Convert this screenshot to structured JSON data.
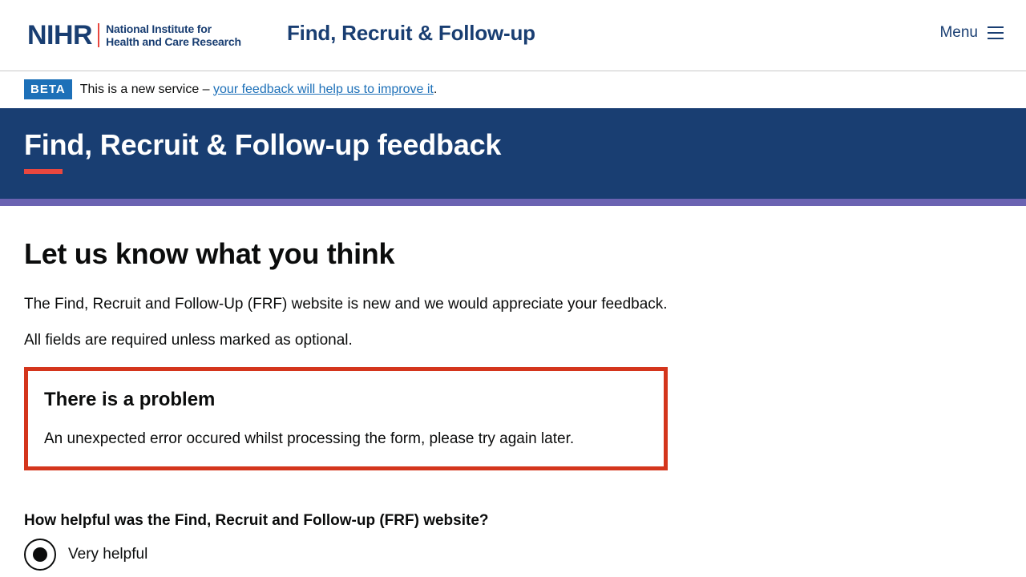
{
  "header": {
    "logo_mark": "NIHR",
    "logo_line1": "National Institute for",
    "logo_line2": "Health and Care Research",
    "service_name": "Find, Recruit & Follow-up",
    "menu_label": "Menu"
  },
  "beta": {
    "tag": "BETA",
    "text": "This is a new service – ",
    "link": "your feedback will help us to improve it",
    "suffix": "."
  },
  "hero": {
    "title": "Find, Recruit & Follow-up feedback"
  },
  "main": {
    "heading": "Let us know what you think",
    "intro": "The Find, Recruit and Follow-Up (FRF) website is new and we would appreciate your feedback.",
    "required_note": "All fields are required unless marked as optional."
  },
  "error_summary": {
    "title": "There is a problem",
    "message": "An unexpected error occured whilst processing the form, please try again later."
  },
  "form": {
    "question": "How helpful was the Find, Recruit and Follow-up (FRF) website?",
    "options": [
      {
        "label": "Very helpful",
        "selected": true
      }
    ]
  },
  "colors": {
    "brand_navy": "#193e72",
    "accent_red": "#e9473f",
    "stripe_purple": "#6b63b2",
    "link_blue": "#1d70b8",
    "error_red": "#d4351c"
  }
}
